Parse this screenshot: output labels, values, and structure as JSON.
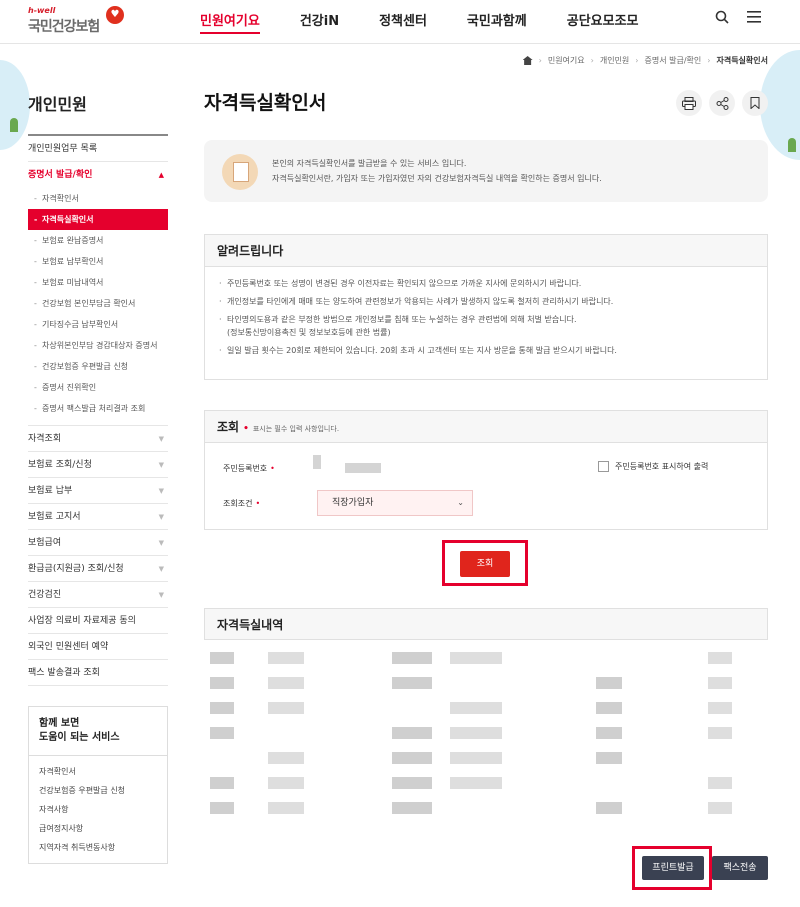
{
  "header": {
    "logo_sub": "h-well",
    "logo_main": "국민건강보험",
    "nav": [
      "민원여기요",
      "건강iN",
      "정책센터",
      "국민과함께",
      "공단요모조모"
    ],
    "active_nav_index": 0
  },
  "breadcrumb": [
    "민원여기요",
    "개인민원",
    "증명서 발급/확인",
    "자격득실확인서"
  ],
  "sidebar": {
    "title": "개인민원",
    "item_list": "개인민원업무 목록",
    "open_section": "증명서 발급/확인",
    "sub_items": [
      "자격확인서",
      "자격득실확인서",
      "보험료 완납증명서",
      "보험료 납부확인서",
      "보험료 미납내역서",
      "건강보험 본인부담금 확인서",
      "기타징수금 납부확인서",
      "차상위본인부담 경감대상자 증명서",
      "건강보험증 우편발급 신청",
      "증명서 진위확인",
      "증명서 팩스발급 처리결과 조회"
    ],
    "active_sub_index": 1,
    "items": [
      "자격조회",
      "보험료 조회/신청",
      "보험료 납부",
      "보험료 고지서",
      "보험급여",
      "환급금(지원금) 조회/신청",
      "건강검진",
      "사업장 의료비 자료제공 동의",
      "외국인 민원센터 예약",
      "팩스 발송결과 조회"
    ],
    "items_with_arrow": [
      true,
      true,
      true,
      true,
      true,
      true,
      true,
      false,
      false,
      false
    ],
    "related": {
      "title_line1": "함께 보면",
      "title_line2": "도움이 되는 서비스",
      "items": [
        "자격확인서",
        "건강보험증 우편발급 신청",
        "자격사항",
        "급여정지사항",
        "지역자격 취득변동사항"
      ]
    }
  },
  "main": {
    "title": "자격득실확인서",
    "intro_line1": "본인의 자격득실확인서를 발급받을 수 있는 서비스 입니다.",
    "intro_line2": "자격득실확인서란, 가입자 또는 가입자였던 자의 건강보험자격득실 내역을 확인하는 증명서 입니다.",
    "notice": {
      "title": "알려드립니다",
      "items": [
        "주민등록번호 또는 성명이 변경된 경우 이전자료는 확인되지 않으므로 가까운 지사에 문의하시기 바랍니다.",
        "개인정보를 타인에게 매매 또는 양도하여 관련정보가 악용되는 사례가 발생하지 않도록 철저히 관리하시기 바랍니다.",
        "타인명의도용과 같은 부정한 방법으로 개인정보를 침해 또는 누설하는 경우 관련법에 의해 처벌 받습니다.",
        "일일 발급 횟수는 20회로 제한되어 있습니다. 20회 초과 시 고객센터 또는 지사 방문을 통해 발급 받으시기 바랍니다."
      ],
      "item3_cont": "(정보통신망이용촉진 및 정보보호등에 관한 법률)"
    },
    "search": {
      "title": "조회",
      "required_note": "표시는 필수 입력 사항입니다.",
      "id_label": "주민등록번호",
      "check_label": "주민등록번호 표시하여 출력",
      "cond_label": "조회조건",
      "cond_value": "직장가입자",
      "button": "조회"
    },
    "result": {
      "title": "자격득실내역"
    },
    "buttons": {
      "print": "프린트발급",
      "fax": "팩스전송"
    }
  }
}
